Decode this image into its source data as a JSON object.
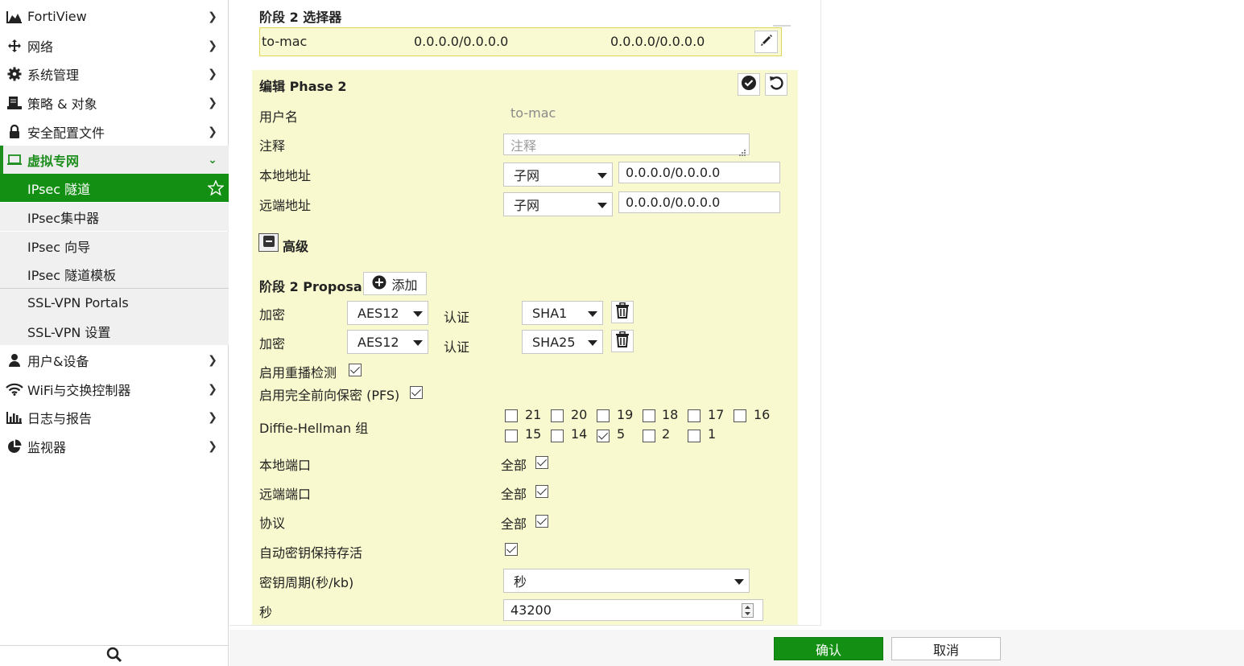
{
  "sidebar": {
    "items": [
      {
        "label": "FortiView",
        "icon": "chart-area-icon"
      },
      {
        "label": "网络",
        "icon": "move-arrows-icon"
      },
      {
        "label": "系统管理",
        "icon": "gear-icon"
      },
      {
        "label": "策略 & 对象",
        "icon": "document-icon"
      },
      {
        "label": "安全配置文件",
        "icon": "lock-icon"
      },
      {
        "label": "虚拟专网",
        "icon": "laptop-icon"
      },
      {
        "label": "用户&设备",
        "icon": "user-icon"
      },
      {
        "label": "WiFi与交换控制器",
        "icon": "wifi-icon"
      },
      {
        "label": "日志与报告",
        "icon": "bar-chart-icon"
      },
      {
        "label": "监视器",
        "icon": "pie-chart-icon"
      }
    ],
    "vpn_subitems": [
      "IPsec 隧道",
      "IPsec集中器",
      "IPsec 向导",
      "IPsec 隧道模板",
      "SSL-VPN Portals",
      "SSL-VPN 设置"
    ],
    "active_subitem": "IPsec 隧道"
  },
  "selector": {
    "title": "阶段 2 选择器",
    "row": {
      "name": "to-mac",
      "local": "0.0.0.0/0.0.0.0",
      "remote": "0.0.0.0/0.0.0.0"
    }
  },
  "edit": {
    "title": "编辑 Phase 2",
    "username_label": "用户名",
    "username_value": "to-mac",
    "comment_label": "注释",
    "comment_placeholder": "注释",
    "local_addr_label": "本地地址",
    "local_addr_type": "子网",
    "local_addr_value": "0.0.0.0/0.0.0.0",
    "remote_addr_label": "远端地址",
    "remote_addr_type": "子网",
    "remote_addr_value": "0.0.0.0/0.0.0.0",
    "advanced_label": "高级",
    "proposal_label": "阶段 2 Proposal",
    "add_label": "添加",
    "proposals": [
      {
        "enc_label": "加密",
        "enc": "AES12",
        "auth_label": "认证",
        "auth": "SHA1"
      },
      {
        "enc_label": "加密",
        "enc": "AES12",
        "auth_label": "认证",
        "auth": "SHA25"
      }
    ],
    "replay_label": "启用重播检测",
    "pfs_label": "启用完全前向保密 (PFS)",
    "dh_label": "Diffie-Hellman 组",
    "dh_groups_row1": [
      "21",
      "20",
      "19",
      "18",
      "17",
      "16"
    ],
    "dh_groups_row2": [
      "15",
      "14",
      "5",
      "2",
      "1"
    ],
    "dh_checked": [
      "5"
    ],
    "local_port_label": "本地端口",
    "remote_port_label": "远端端口",
    "protocol_label": "协议",
    "all_label": "全部",
    "autokey_label": "自动密钥保持存活",
    "key_lifetime_label": "密钥周期(秒/kb)",
    "key_lifetime_value": "秒",
    "seconds_label": "秒",
    "seconds_value": "43200"
  },
  "footer": {
    "ok_label": "确认",
    "cancel_label": "取消"
  },
  "colors": {
    "accent": "#139013",
    "edit_bg": "#f9f9cf",
    "selector_border": "#e0d45a"
  }
}
